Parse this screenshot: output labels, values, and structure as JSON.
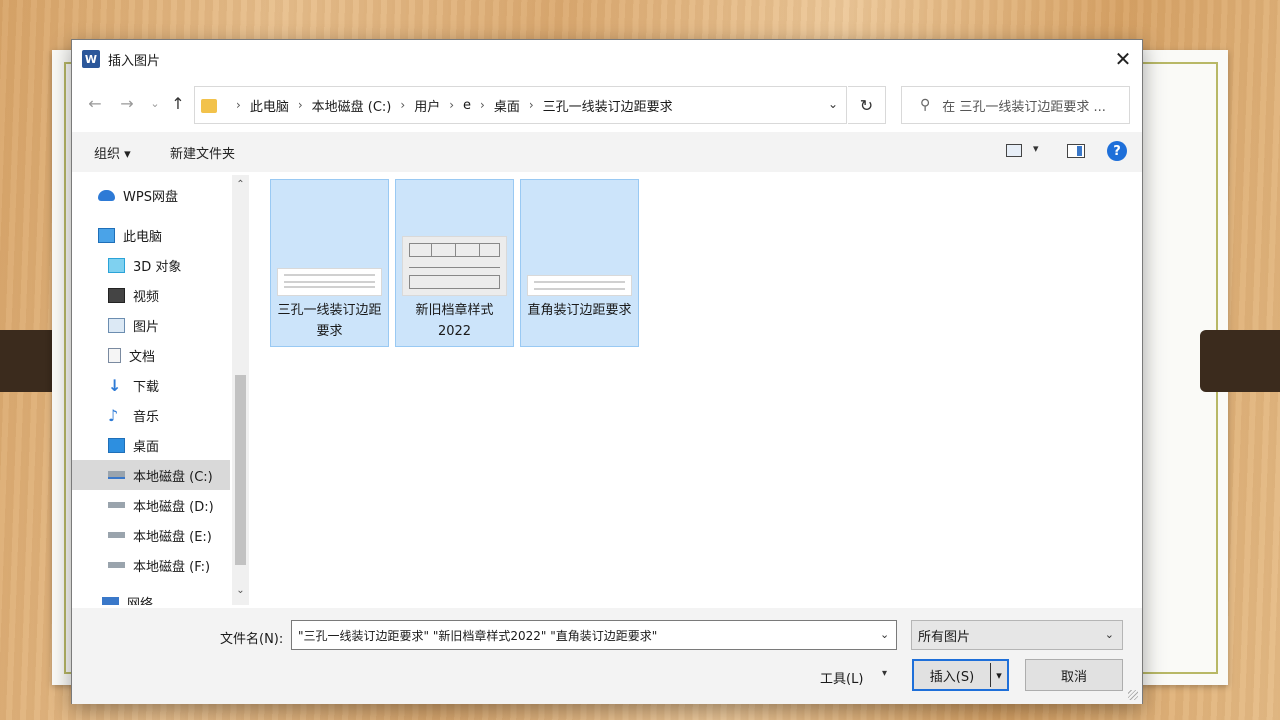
{
  "dialog": {
    "title": "插入图片",
    "app_icon": "W",
    "close_glyph": "✕"
  },
  "nav": {
    "back_glyph": "←",
    "forward_glyph": "→",
    "recent_glyph": "⌄",
    "up_glyph": "↑",
    "breadcrumbs": [
      "此电脑",
      "本地磁盘 (C:)",
      "用户",
      "e",
      "桌面",
      "三孔一线装订边距要求"
    ],
    "separator": "›",
    "dropdown_glyph": "⌄",
    "refresh_glyph": "↻",
    "search_placeholder": "在 三孔一线装订边距要求 ...",
    "search_glyph": "⚲"
  },
  "toolbar": {
    "organize": "组织 ▾",
    "new_folder": "新建文件夹",
    "view_dropdown": "▾",
    "help": "?"
  },
  "sidebar": {
    "items": [
      {
        "label": "WPS网盘",
        "icon": "cloud-icon"
      },
      {
        "label": "此电脑",
        "icon": "computer-icon"
      },
      {
        "label": "3D 对象",
        "icon": "3d-objects-icon"
      },
      {
        "label": "视频",
        "icon": "video-icon"
      },
      {
        "label": "图片",
        "icon": "pictures-icon"
      },
      {
        "label": "文档",
        "icon": "documents-icon"
      },
      {
        "label": "下载",
        "icon": "download-icon"
      },
      {
        "label": "音乐",
        "icon": "music-icon"
      },
      {
        "label": "桌面",
        "icon": "desktop-icon"
      },
      {
        "label": "本地磁盘 (C:)",
        "icon": "drive-icon",
        "selected": true
      },
      {
        "label": "本地磁盘 (D:)",
        "icon": "drive-icon"
      },
      {
        "label": "本地磁盘 (E:)",
        "icon": "drive-icon"
      },
      {
        "label": "本地磁盘 (F:)",
        "icon": "drive-icon"
      },
      {
        "label": "网络",
        "icon": "network-icon"
      }
    ],
    "scroll_up": "⌃",
    "scroll_down": "⌄"
  },
  "files": [
    {
      "name": "三孔一线装订边距要求",
      "thumb": "document-thumbnail"
    },
    {
      "name": "新旧档章样式2022",
      "thumb": "stamp-table-thumbnail"
    },
    {
      "name": "直角装订边距要求",
      "thumb": "document-thumbnail"
    }
  ],
  "footer": {
    "filename_label": "文件名(N):",
    "filename_value": "\"三孔一线装订边距要求\" \"新旧档章样式2022\" \"直角装订边距要求\"",
    "filename_dropdown": "⌄",
    "filter_value": "所有图片",
    "filter_dropdown": "⌄",
    "tools_label": "工具(L)",
    "tools_dropdown": "▾",
    "insert_label": "插入(S)",
    "insert_dropdown": "▾",
    "cancel_label": "取消"
  },
  "colors": {
    "selection": "#cce4fa",
    "selection_border": "#99c9f3",
    "accent": "#1e6fd9",
    "folder": "#f2c24b"
  }
}
